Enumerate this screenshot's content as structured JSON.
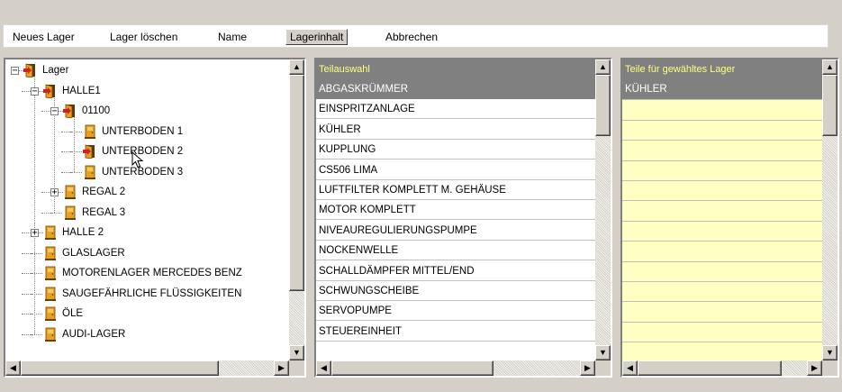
{
  "toolbar": {
    "items": [
      "Neues Lager",
      "Lager löschen",
      "Name",
      "Lagerinhalt",
      "Abbrechen"
    ],
    "active": "Lagerinhalt"
  },
  "tree": {
    "nodes": [
      {
        "label": "Lager",
        "level": 0,
        "expander": "−",
        "icon": "door-open-icon"
      },
      {
        "label": "HALLE1",
        "level": 1,
        "expander": "−",
        "icon": "door-open-icon"
      },
      {
        "label": "01100",
        "level": 2,
        "expander": "−",
        "icon": "door-open-icon"
      },
      {
        "label": "UNTERBODEN 1",
        "level": 3,
        "expander": "",
        "icon": "door-closed-icon"
      },
      {
        "label": "UNTERBODEN 2",
        "level": 3,
        "expander": "",
        "icon": "door-open-icon"
      },
      {
        "label": "UNTERBODEN 3",
        "level": 3,
        "expander": "",
        "icon": "door-closed-icon"
      },
      {
        "label": "REGAL 2",
        "level": 2,
        "expander": "+",
        "icon": "door-closed-icon"
      },
      {
        "label": "REGAL 3",
        "level": 2,
        "expander": "",
        "icon": "door-closed-icon"
      },
      {
        "label": "HALLE 2",
        "level": 1,
        "expander": "+",
        "icon": "door-closed-icon"
      },
      {
        "label": "GLASLAGER",
        "level": 1,
        "expander": "",
        "icon": "door-closed-icon"
      },
      {
        "label": "MOTORENLAGER MERCEDES BENZ",
        "level": 1,
        "expander": "",
        "icon": "door-closed-icon"
      },
      {
        "label": "SAUGEFÄHRLICHE FLÜSSIGKEITEN",
        "level": 1,
        "expander": "",
        "icon": "door-closed-icon"
      },
      {
        "label": "ÖLE",
        "level": 1,
        "expander": "",
        "icon": "door-closed-icon"
      },
      {
        "label": "AUDI-LAGER",
        "level": 1,
        "expander": "",
        "icon": "door-closed-icon"
      }
    ]
  },
  "parts_list": {
    "header": "Teilauswahl",
    "selected": "ABGASKRÜMMER",
    "items": [
      "ABGASKRÜMMER",
      "EINSPRITZANLAGE",
      "KÜHLER",
      "KUPPLUNG",
      "CS506 LIMA",
      "LUFTFILTER KOMPLETT M. GEHÄUSE",
      "MOTOR KOMPLETT",
      "NIVEAUREGULIERUNGSPUMPE",
      "NOCKENWELLE",
      "SCHALLDÄMPFER MITTEL/END",
      "SCHWUNGSCHEIBE",
      "SERVOPUMPE",
      "STEUEREINHEIT"
    ]
  },
  "stock_list": {
    "header": "Teile für gewähltes Lager",
    "items": [
      "KÜHLER"
    ]
  },
  "colors": {
    "window_bg": "#d4d0c8",
    "header_text": "#ffff80",
    "selected_row_bg": "#808080",
    "stock_list_bg": "#ffffc4"
  }
}
